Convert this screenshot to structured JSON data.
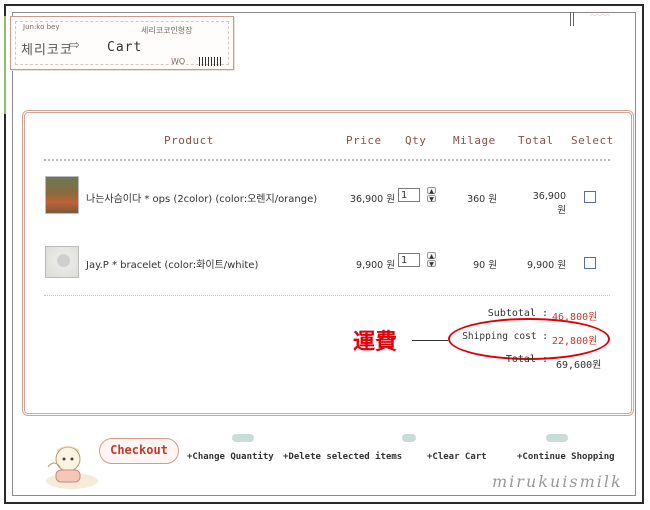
{
  "header": {
    "brand_small": "Jun:ko bey",
    "brand_sub": "세리코코인형장",
    "brand": "체리코코",
    "cart_title": "Cart",
    "tag_code": "WO"
  },
  "table": {
    "columns": [
      "Product",
      "Price",
      "Qty",
      "Milage",
      "Total",
      "Select"
    ],
    "rows": [
      {
        "product": "나는사슴이다 * ops (2color) (color:오렌지/orange)",
        "price": "36,900 원",
        "qty": "1",
        "milage": "360 원",
        "total": "36,900 원"
      },
      {
        "product": "Jay.P * bracelet (color:화이트/white)",
        "price": "9,900 원",
        "qty": "1",
        "milage": "90 원",
        "total": "9,900 원"
      }
    ]
  },
  "summary": {
    "subtotal_label": "Subtotal :",
    "subtotal_value": "46,800원",
    "shipping_label": "Shipping cost :",
    "shipping_value": "22,800원",
    "total_label": "Total :",
    "total_value": "69,600원"
  },
  "annotation": {
    "text": "運費"
  },
  "actions": {
    "checkout": "Checkout",
    "change_quantity": "+Change Quantity",
    "delete_selected": "+Delete selected items",
    "clear_cart": "+Clear Cart",
    "continue_shopping": "+Continue Shopping"
  },
  "watermark": "mirukuismilk",
  "colors": {
    "accent": "#c0392b",
    "annotation": "#e0000a",
    "border": "#cfa397"
  }
}
